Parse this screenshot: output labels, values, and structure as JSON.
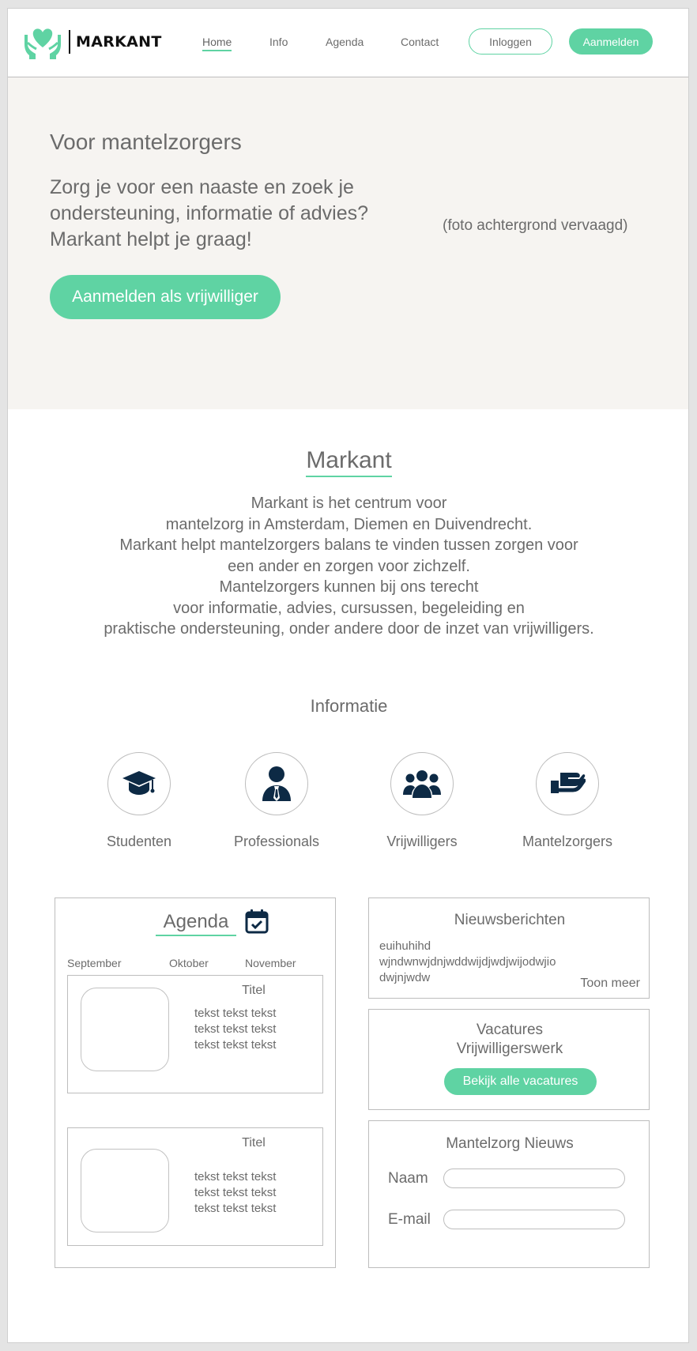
{
  "header": {
    "logo_text": "MARKANT",
    "nav": [
      "Home",
      "Info",
      "Agenda",
      "Contact"
    ],
    "login_label": "Inloggen",
    "signup_label": "Aanmelden"
  },
  "hero": {
    "title": "Voor mantelzorgers",
    "text": "Zorg je voor een naaste en zoek je ondersteuning, informatie of advies? Markant helpt je graag!",
    "photo_note": "(foto achtergrond vervaagd)",
    "button_label": "Aanmelden als vrijwilliger"
  },
  "about": {
    "title": "Markant",
    "lines": [
      "Markant is het centrum voor",
      "mantelzorg in Amsterdam, Diemen en Duivendrecht.",
      "Markant helpt mantelzorgers balans te vinden tussen zorgen voor",
      "een ander en zorgen voor zichzelf.",
      "Mantelzorgers kunnen bij ons terecht",
      "voor informatie, advies, cursussen, begeleiding en",
      "praktische ondersteuning, onder andere door de inzet van vrijwilligers."
    ]
  },
  "info": {
    "title": "Informatie",
    "categories": [
      {
        "label": "Studenten",
        "icon": "graduation-cap-icon"
      },
      {
        "label": "Professionals",
        "icon": "professional-person-icon"
      },
      {
        "label": "Vrijwilligers",
        "icon": "group-users-icon"
      },
      {
        "label": "Mantelzorgers",
        "icon": "hand-care-icon"
      }
    ]
  },
  "agenda": {
    "title": "Agenda",
    "months": [
      "September",
      "Oktober",
      "November"
    ],
    "events": [
      {
        "title": "Titel",
        "lines": [
          "tekst tekst tekst",
          "tekst tekst tekst",
          "tekst tekst tekst"
        ]
      },
      {
        "title": "Titel",
        "lines": [
          "tekst tekst tekst",
          "tekst tekst tekst",
          "tekst tekst tekst"
        ]
      }
    ]
  },
  "news": {
    "title": "Nieuwsberichten",
    "lines": [
      "euihuhihd",
      "wjndwnwjdnjwddwijdjwdjwijodwjio",
      "dwjnjwdw"
    ],
    "more_label": "Toon meer"
  },
  "vacancies": {
    "title": "Vacatures",
    "subtitle": "Vrijwilligerswerk",
    "button_label": "Bekijk alle vacatures"
  },
  "newsletter": {
    "title": "Mantelzorg Nieuws",
    "name_label": "Naam",
    "email_label": "E-mail",
    "name_value": "",
    "email_value": ""
  },
  "colors": {
    "accent": "#5fd3a3",
    "navy_icon": "#0d2a45",
    "hero_bg": "#f6f4f1",
    "text": "#6b6b6b"
  }
}
